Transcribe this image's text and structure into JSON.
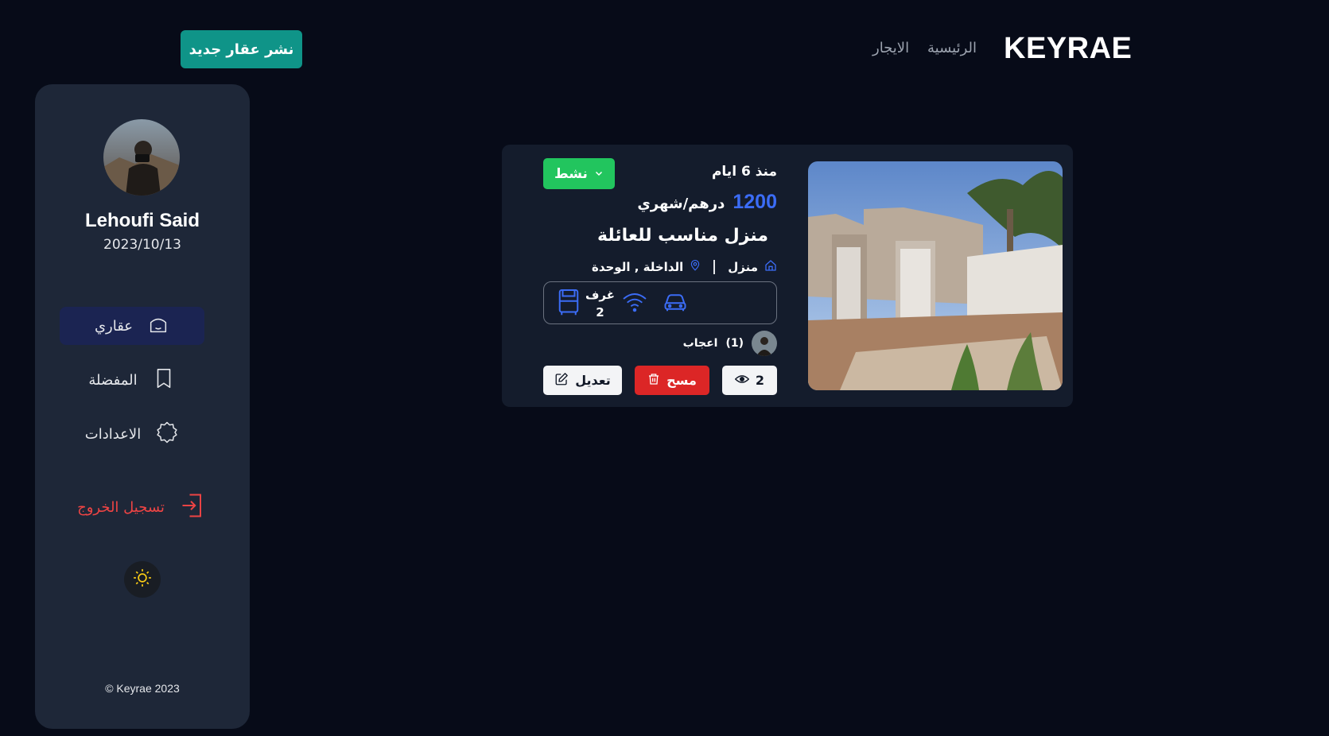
{
  "header": {
    "logo": "KEYRAE",
    "nav": {
      "home": "الرئيسية",
      "rent": "الايجار"
    },
    "publish_button": "نشر عقار جديد"
  },
  "sidebar": {
    "user_name": "Lehoufi Said",
    "user_date": "2023/10/13",
    "menu": {
      "properties": "عقاري",
      "favorites": "المفضلة",
      "settings": "الاعدادات",
      "logout": "تسجيل الخروج"
    },
    "copyright": "© Keyrae 2023"
  },
  "listing": {
    "since": "منذ 6 ايام",
    "status": "نشط",
    "price": "1200",
    "price_unit": "درهم/شهري",
    "title": "منزل مناسب للعائلة",
    "type": "منزل",
    "location": "الداخلة , الوحدة",
    "rooms_label": "غرف",
    "rooms_count": "2",
    "likes_count": "(1)",
    "likes_label": "اعجاب",
    "views": "2",
    "delete_label": "مسح",
    "edit_label": "تعديل"
  },
  "colors": {
    "background": "#070b18",
    "sidebar": "#1e2738",
    "card": "#141c2c",
    "accent_teal": "#0f9488",
    "active_green": "#22c55e",
    "price_blue": "#3b6cf6",
    "danger": "#dc2626"
  },
  "icons": {
    "home": "home-icon",
    "bookmark": "bookmark-icon",
    "settings": "gear-icon",
    "logout": "logout-icon",
    "theme": "sun-icon",
    "location": "map-pin-icon",
    "wifi": "wifi-icon",
    "car": "car-icon",
    "bed": "bed-icon",
    "eye": "eye-icon",
    "trash": "trash-icon",
    "edit": "edit-icon"
  }
}
